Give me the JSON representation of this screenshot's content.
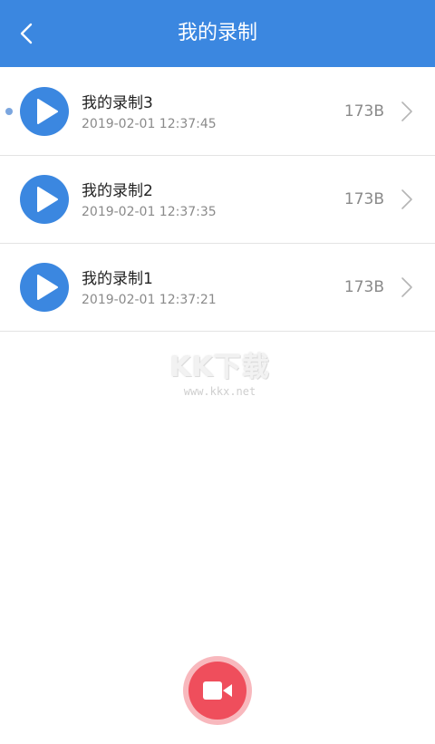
{
  "header": {
    "title": "我的录制",
    "background_color": "#3b87e0",
    "back_icon": "chevron-left-icon"
  },
  "recordings": [
    {
      "name": "我的录制3",
      "time": "2019-02-01 12:37:45",
      "size": "173B",
      "is_new": true
    },
    {
      "name": "我的录制2",
      "time": "2019-02-01 12:37:35",
      "size": "173B",
      "is_new": false
    },
    {
      "name": "我的录制1",
      "time": "2019-02-01 12:37:21",
      "size": "173B",
      "is_new": false
    }
  ],
  "watermark": {
    "text": "KK下载",
    "url": "www.kkx.net"
  },
  "record_button": {
    "icon": "video-camera-icon",
    "color": "#ef4e5c"
  },
  "colors": {
    "accent": "#3b87e0",
    "record": "#ef4e5c"
  }
}
